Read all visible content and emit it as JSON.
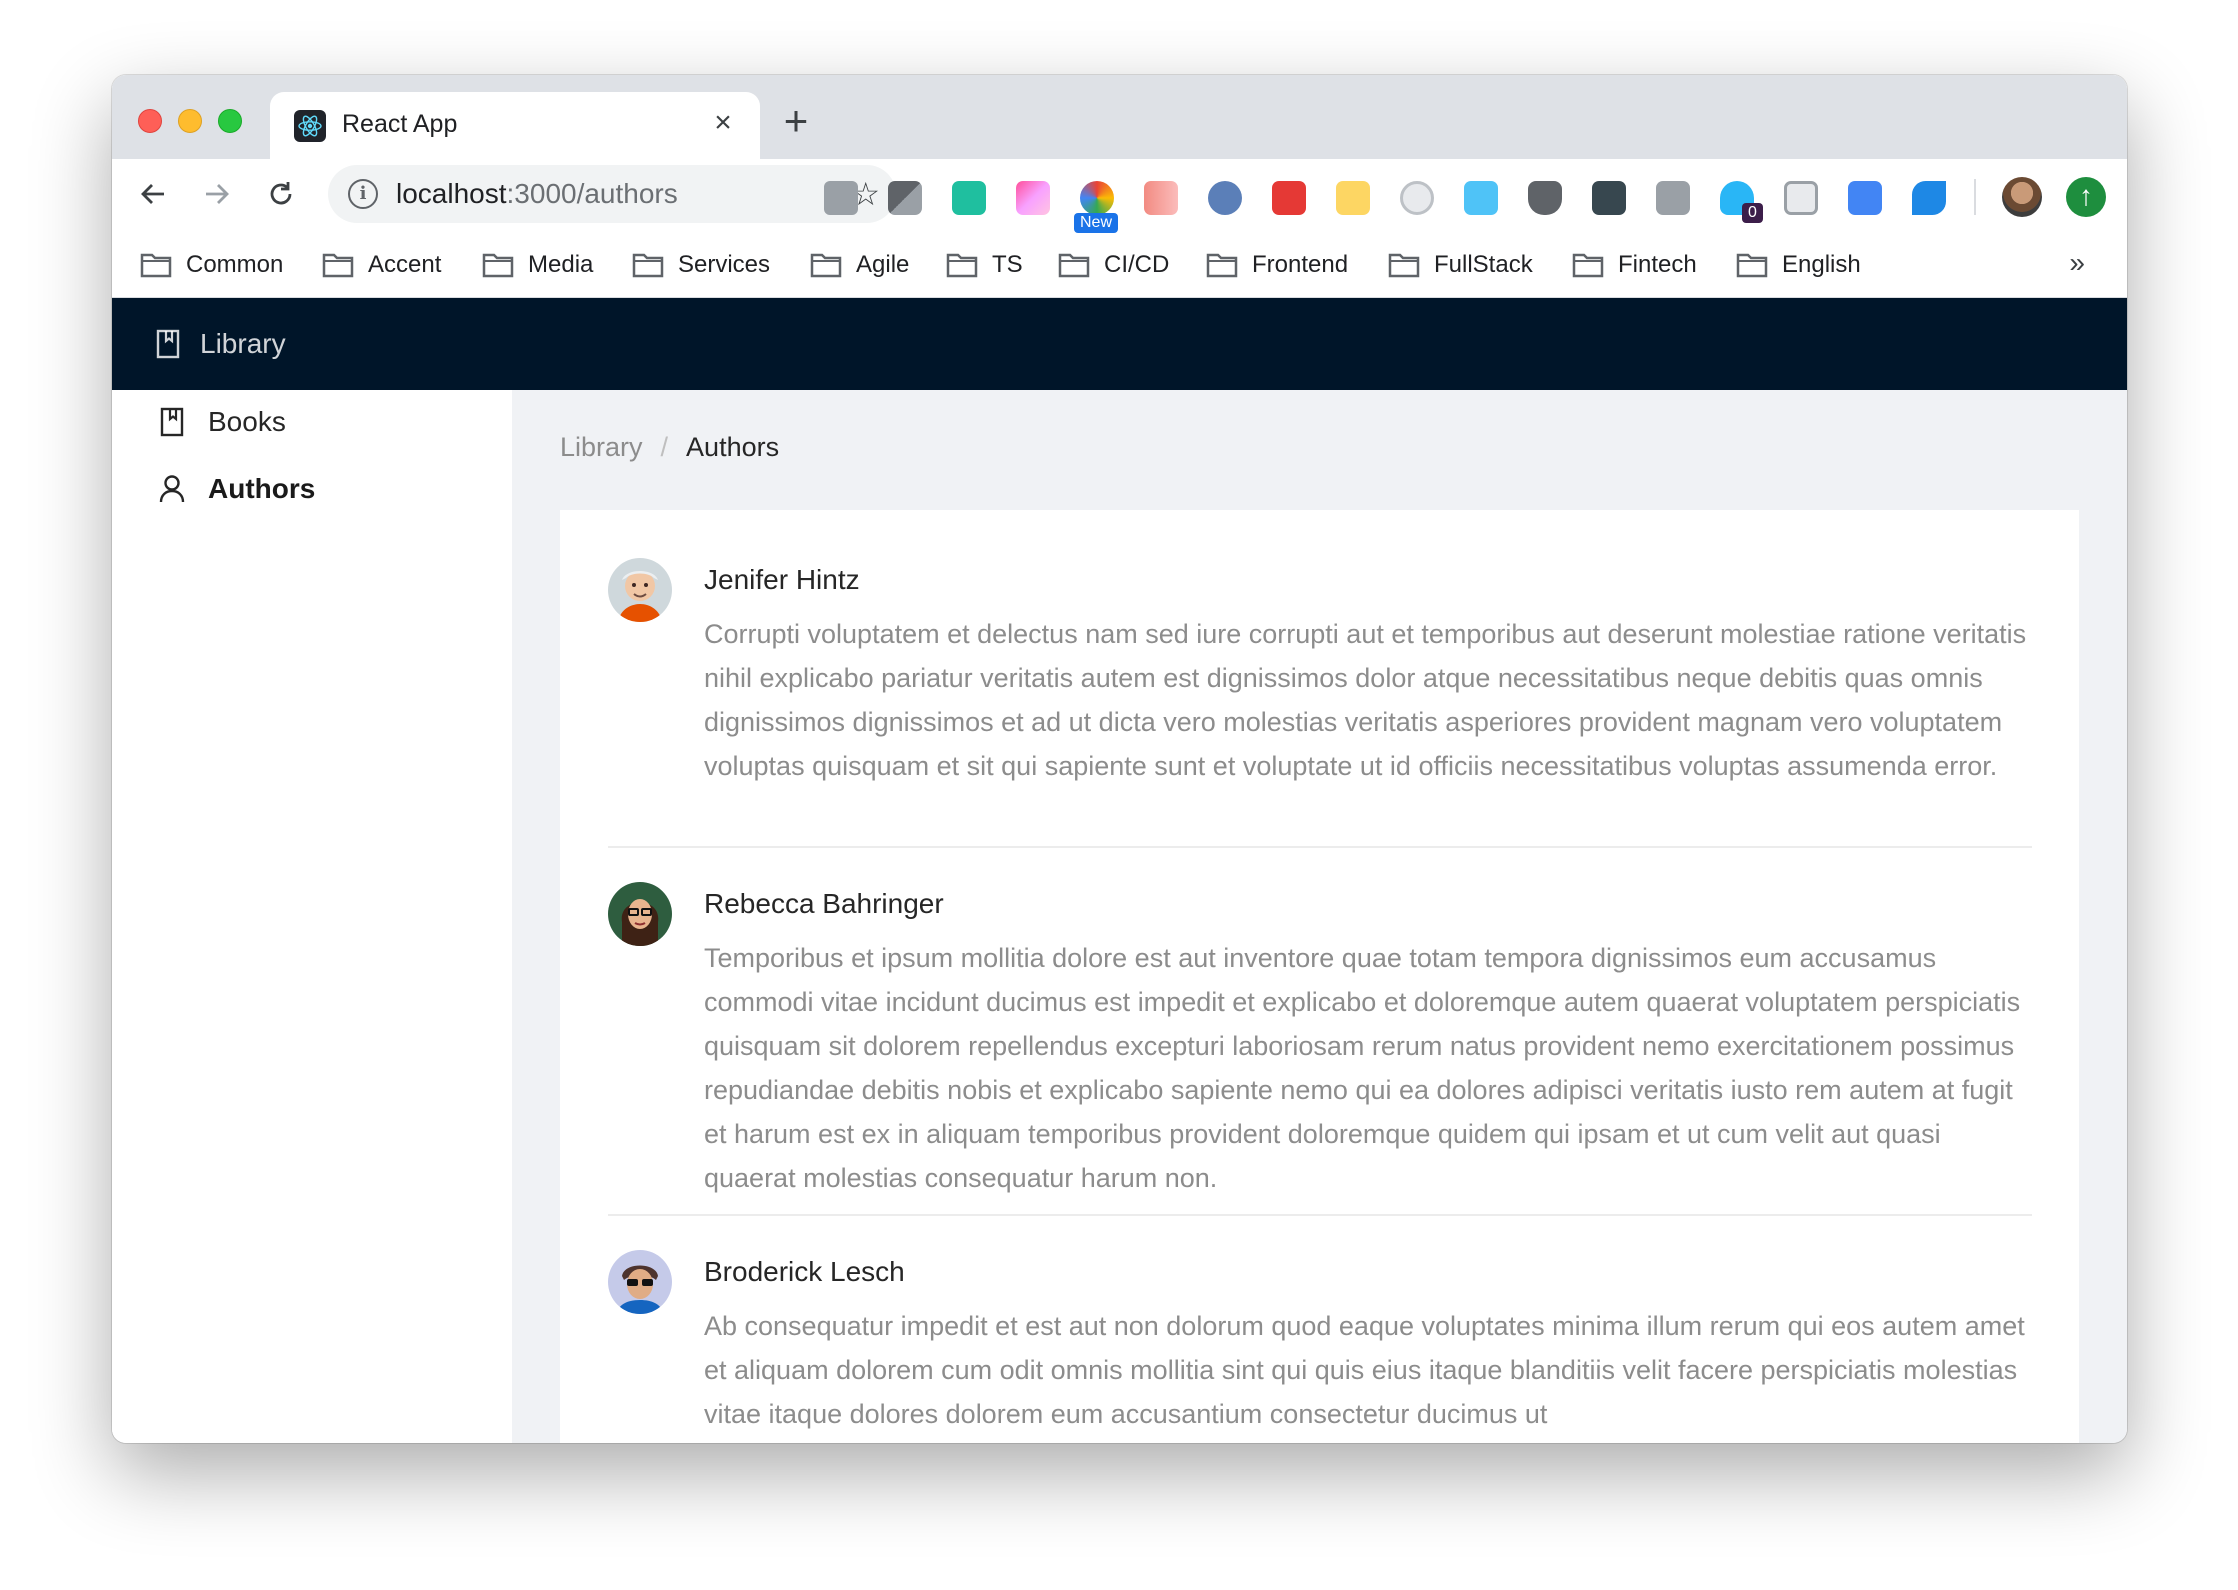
{
  "browser": {
    "tab_title": "React App",
    "tab_close": "×",
    "new_tab": "+",
    "url_host": "localhost",
    "url_rest": ":3000/authors",
    "ext_new_badge": "New",
    "ext_counter_badge": "0",
    "bookmarks": [
      "Common",
      "Accent",
      "Media",
      "Services",
      "Agile",
      "TS",
      "CI/CD",
      "Frontend",
      "FullStack",
      "Fintech",
      "English"
    ],
    "bookmarks_more": "»"
  },
  "app": {
    "header_title": "Library",
    "sidebar": {
      "items": [
        {
          "label": "Books",
          "icon": "book-icon",
          "selected": false
        },
        {
          "label": "Authors",
          "icon": "user-icon",
          "selected": true
        }
      ]
    },
    "breadcrumb": {
      "root": "Library",
      "separator": "/",
      "current": "Authors"
    },
    "authors": [
      {
        "name": "Jenifer Hintz",
        "bio": "Corrupti voluptatem et delectus nam sed iure corrupti aut et temporibus aut deserunt molestiae ratione veritatis nihil explicabo pariatur veritatis autem est dignissimos dolor atque necessitatibus neque debitis quas omnis dignissimos dignissimos et ad ut dicta vero molestias veritatis asperiores provident magnam vero voluptatem voluptas quisquam et sit qui sapiente sunt et voluptate ut id officiis necessitatibus voluptas assumenda error."
      },
      {
        "name": "Rebecca Bahringer",
        "bio": "Temporibus et ipsum mollitia dolore est aut inventore quae totam tempora dignissimos eum accusamus commodi vitae incidunt ducimus est impedit et explicabo et doloremque autem quaerat voluptatem perspiciatis quisquam sit dolorem repellendus excepturi laboriosam rerum natus provident nemo exercitationem possimus repudiandae debitis nobis et explicabo sapiente nemo qui ea dolores adipisci veritatis iusto rem autem at fugit et harum est ex in aliquam temporibus provident doloremque quidem qui ipsam et ut cum velit aut quasi quaerat molestias consequatur harum non."
      },
      {
        "name": "Broderick Lesch",
        "bio": "Ab consequatur impedit et est aut non dolorum quod eaque voluptates minima illum rerum qui eos autem amet et aliquam dolorem cum odit omnis mollitia sint qui quis eius itaque blanditiis velit facere perspiciatis molestias vitae itaque dolores dolorem eum accusantium consectetur ducimus ut"
      }
    ]
  },
  "colors": {
    "header_bg": "#001529",
    "layout_bg": "#f0f2f5",
    "text_primary": "#262626",
    "text_secondary": "#8c8c8c"
  }
}
